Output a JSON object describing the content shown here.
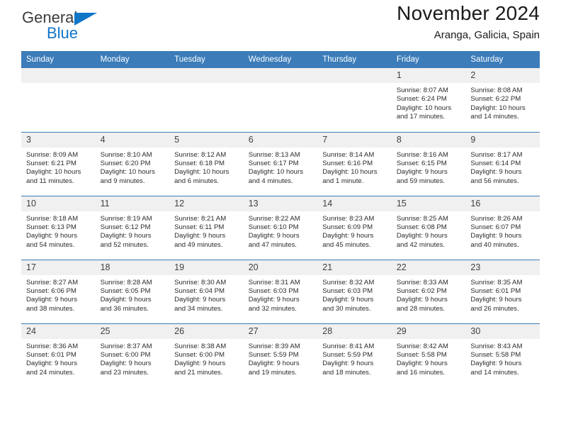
{
  "brand": {
    "name_top": "General",
    "name_bottom": "Blue",
    "accent_color": "#1175c8",
    "triangle_icon": "brand-triangle-icon"
  },
  "header": {
    "title": "November 2024",
    "subtitle": "Aranga, Galicia, Spain"
  },
  "calendar": {
    "header_bg": "#3b7cb9",
    "header_text_color": "#ffffff",
    "daynum_bg": "#f0f0f0",
    "weekday_headers": [
      "Sunday",
      "Monday",
      "Tuesday",
      "Wednesday",
      "Thursday",
      "Friday",
      "Saturday"
    ],
    "labels": {
      "sunrise": "Sunrise:",
      "sunset": "Sunset:",
      "daylight": "Daylight:"
    },
    "weeks": [
      [
        {
          "day": ""
        },
        {
          "day": ""
        },
        {
          "day": ""
        },
        {
          "day": ""
        },
        {
          "day": ""
        },
        {
          "day": "1",
          "sunrise": "Sunrise: 8:07 AM",
          "sunset": "Sunset: 6:24 PM",
          "daylight_line1": "Daylight: 10 hours",
          "daylight_line2": "and 17 minutes."
        },
        {
          "day": "2",
          "sunrise": "Sunrise: 8:08 AM",
          "sunset": "Sunset: 6:22 PM",
          "daylight_line1": "Daylight: 10 hours",
          "daylight_line2": "and 14 minutes."
        }
      ],
      [
        {
          "day": "3",
          "sunrise": "Sunrise: 8:09 AM",
          "sunset": "Sunset: 6:21 PM",
          "daylight_line1": "Daylight: 10 hours",
          "daylight_line2": "and 11 minutes."
        },
        {
          "day": "4",
          "sunrise": "Sunrise: 8:10 AM",
          "sunset": "Sunset: 6:20 PM",
          "daylight_line1": "Daylight: 10 hours",
          "daylight_line2": "and 9 minutes."
        },
        {
          "day": "5",
          "sunrise": "Sunrise: 8:12 AM",
          "sunset": "Sunset: 6:18 PM",
          "daylight_line1": "Daylight: 10 hours",
          "daylight_line2": "and 6 minutes."
        },
        {
          "day": "6",
          "sunrise": "Sunrise: 8:13 AM",
          "sunset": "Sunset: 6:17 PM",
          "daylight_line1": "Daylight: 10 hours",
          "daylight_line2": "and 4 minutes."
        },
        {
          "day": "7",
          "sunrise": "Sunrise: 8:14 AM",
          "sunset": "Sunset: 6:16 PM",
          "daylight_line1": "Daylight: 10 hours",
          "daylight_line2": "and 1 minute."
        },
        {
          "day": "8",
          "sunrise": "Sunrise: 8:16 AM",
          "sunset": "Sunset: 6:15 PM",
          "daylight_line1": "Daylight: 9 hours",
          "daylight_line2": "and 59 minutes."
        },
        {
          "day": "9",
          "sunrise": "Sunrise: 8:17 AM",
          "sunset": "Sunset: 6:14 PM",
          "daylight_line1": "Daylight: 9 hours",
          "daylight_line2": "and 56 minutes."
        }
      ],
      [
        {
          "day": "10",
          "sunrise": "Sunrise: 8:18 AM",
          "sunset": "Sunset: 6:13 PM",
          "daylight_line1": "Daylight: 9 hours",
          "daylight_line2": "and 54 minutes."
        },
        {
          "day": "11",
          "sunrise": "Sunrise: 8:19 AM",
          "sunset": "Sunset: 6:12 PM",
          "daylight_line1": "Daylight: 9 hours",
          "daylight_line2": "and 52 minutes."
        },
        {
          "day": "12",
          "sunrise": "Sunrise: 8:21 AM",
          "sunset": "Sunset: 6:11 PM",
          "daylight_line1": "Daylight: 9 hours",
          "daylight_line2": "and 49 minutes."
        },
        {
          "day": "13",
          "sunrise": "Sunrise: 8:22 AM",
          "sunset": "Sunset: 6:10 PM",
          "daylight_line1": "Daylight: 9 hours",
          "daylight_line2": "and 47 minutes."
        },
        {
          "day": "14",
          "sunrise": "Sunrise: 8:23 AM",
          "sunset": "Sunset: 6:09 PM",
          "daylight_line1": "Daylight: 9 hours",
          "daylight_line2": "and 45 minutes."
        },
        {
          "day": "15",
          "sunrise": "Sunrise: 8:25 AM",
          "sunset": "Sunset: 6:08 PM",
          "daylight_line1": "Daylight: 9 hours",
          "daylight_line2": "and 42 minutes."
        },
        {
          "day": "16",
          "sunrise": "Sunrise: 8:26 AM",
          "sunset": "Sunset: 6:07 PM",
          "daylight_line1": "Daylight: 9 hours",
          "daylight_line2": "and 40 minutes."
        }
      ],
      [
        {
          "day": "17",
          "sunrise": "Sunrise: 8:27 AM",
          "sunset": "Sunset: 6:06 PM",
          "daylight_line1": "Daylight: 9 hours",
          "daylight_line2": "and 38 minutes."
        },
        {
          "day": "18",
          "sunrise": "Sunrise: 8:28 AM",
          "sunset": "Sunset: 6:05 PM",
          "daylight_line1": "Daylight: 9 hours",
          "daylight_line2": "and 36 minutes."
        },
        {
          "day": "19",
          "sunrise": "Sunrise: 8:30 AM",
          "sunset": "Sunset: 6:04 PM",
          "daylight_line1": "Daylight: 9 hours",
          "daylight_line2": "and 34 minutes."
        },
        {
          "day": "20",
          "sunrise": "Sunrise: 8:31 AM",
          "sunset": "Sunset: 6:03 PM",
          "daylight_line1": "Daylight: 9 hours",
          "daylight_line2": "and 32 minutes."
        },
        {
          "day": "21",
          "sunrise": "Sunrise: 8:32 AM",
          "sunset": "Sunset: 6:03 PM",
          "daylight_line1": "Daylight: 9 hours",
          "daylight_line2": "and 30 minutes."
        },
        {
          "day": "22",
          "sunrise": "Sunrise: 8:33 AM",
          "sunset": "Sunset: 6:02 PM",
          "daylight_line1": "Daylight: 9 hours",
          "daylight_line2": "and 28 minutes."
        },
        {
          "day": "23",
          "sunrise": "Sunrise: 8:35 AM",
          "sunset": "Sunset: 6:01 PM",
          "daylight_line1": "Daylight: 9 hours",
          "daylight_line2": "and 26 minutes."
        }
      ],
      [
        {
          "day": "24",
          "sunrise": "Sunrise: 8:36 AM",
          "sunset": "Sunset: 6:01 PM",
          "daylight_line1": "Daylight: 9 hours",
          "daylight_line2": "and 24 minutes."
        },
        {
          "day": "25",
          "sunrise": "Sunrise: 8:37 AM",
          "sunset": "Sunset: 6:00 PM",
          "daylight_line1": "Daylight: 9 hours",
          "daylight_line2": "and 23 minutes."
        },
        {
          "day": "26",
          "sunrise": "Sunrise: 8:38 AM",
          "sunset": "Sunset: 6:00 PM",
          "daylight_line1": "Daylight: 9 hours",
          "daylight_line2": "and 21 minutes."
        },
        {
          "day": "27",
          "sunrise": "Sunrise: 8:39 AM",
          "sunset": "Sunset: 5:59 PM",
          "daylight_line1": "Daylight: 9 hours",
          "daylight_line2": "and 19 minutes."
        },
        {
          "day": "28",
          "sunrise": "Sunrise: 8:41 AM",
          "sunset": "Sunset: 5:59 PM",
          "daylight_line1": "Daylight: 9 hours",
          "daylight_line2": "and 18 minutes."
        },
        {
          "day": "29",
          "sunrise": "Sunrise: 8:42 AM",
          "sunset": "Sunset: 5:58 PM",
          "daylight_line1": "Daylight: 9 hours",
          "daylight_line2": "and 16 minutes."
        },
        {
          "day": "30",
          "sunrise": "Sunrise: 8:43 AM",
          "sunset": "Sunset: 5:58 PM",
          "daylight_line1": "Daylight: 9 hours",
          "daylight_line2": "and 14 minutes."
        }
      ]
    ]
  }
}
